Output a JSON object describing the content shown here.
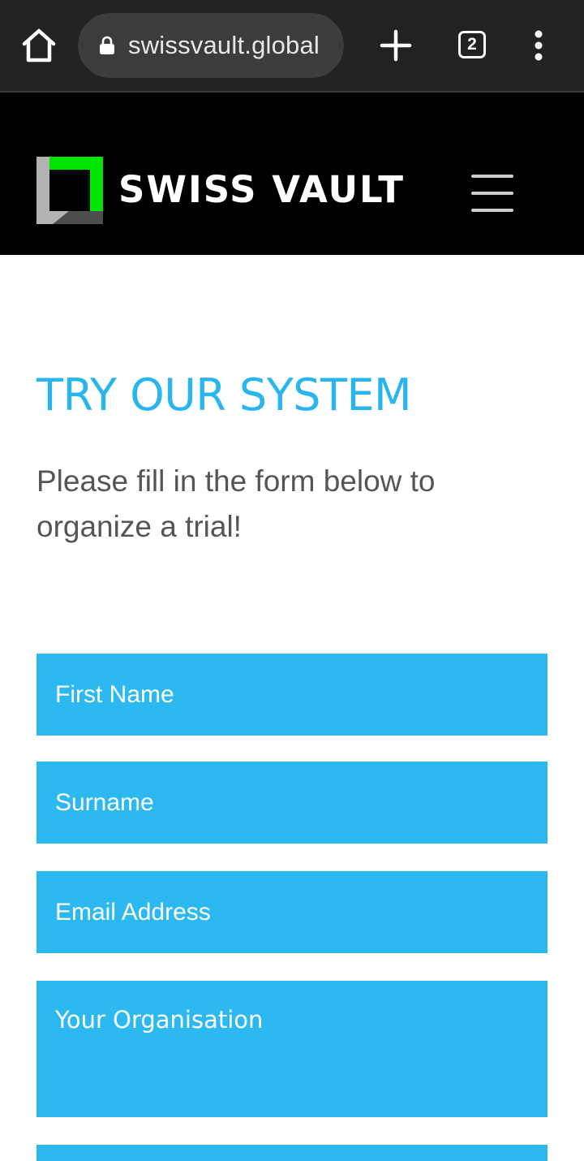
{
  "browser": {
    "url": "swissvault.global",
    "tab_count": "2",
    "icons": [
      "home-icon",
      "lock-icon",
      "new-tab-icon",
      "tab-switcher-icon",
      "more-menu-icon"
    ]
  },
  "header": {
    "brand_name": "SWISS VAULT",
    "logo_colors": {
      "green": "#00e600",
      "gray": "#b3b3b3",
      "dark_gray": "#4d4d4d"
    },
    "menu_icon": "hamburger-menu-icon"
  },
  "main": {
    "title": "TRY OUR SYSTEM",
    "intro": "Please fill in the form below to organize a trial!"
  },
  "form": {
    "first_name_placeholder": "First Name",
    "surname_placeholder": "Surname",
    "email_placeholder": "Email Address",
    "organisation_placeholder": "Your Organisation"
  },
  "colors": {
    "accent": "#29b6ee",
    "field_bg": "#2cb8f1",
    "header_bg": "#000000",
    "browser_bar": "#222222"
  }
}
